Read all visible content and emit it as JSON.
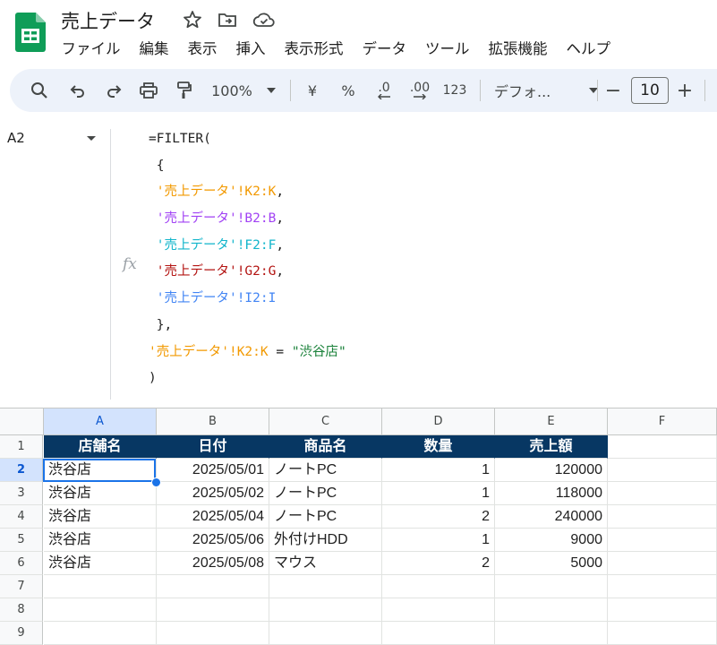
{
  "app": {
    "title": "売上データ",
    "menu": [
      "ファイル",
      "編集",
      "表示",
      "挿入",
      "表示形式",
      "データ",
      "ツール",
      "拡張機能",
      "ヘルプ"
    ]
  },
  "toolbar": {
    "zoom": "100%",
    "currency": "¥",
    "percent": "%",
    "dec_decrease": ".0",
    "dec_increase": ".00",
    "number_format": "123",
    "font": "デフォ...",
    "minus": "−",
    "font_size": "10",
    "plus": "+"
  },
  "formula_bar": {
    "cell_ref": "A2",
    "fx": "fx",
    "line1": "=FILTER(",
    "line2": " {",
    "line3_ref": "'売上データ'!K2:K",
    "line4_ref": "'売上データ'!B2:B",
    "line5_ref": "'売上データ'!F2:F",
    "line6_ref": "'売上データ'!G2:G",
    "line7_ref": "'売上データ'!I2:I",
    "comma": ",",
    "line8": " },",
    "line9_ref": "'売上データ'!K2:K",
    "line9_op": " = ",
    "line9_str": "\"渋谷店\"",
    "line10": ")"
  },
  "sheet": {
    "columns": [
      "A",
      "B",
      "C",
      "D",
      "E",
      "F"
    ],
    "row_numbers": [
      "1",
      "2",
      "3",
      "4",
      "5",
      "6",
      "7",
      "8",
      "9"
    ],
    "header": [
      "店舗名",
      "日付",
      "商品名",
      "数量",
      "売上額"
    ],
    "rows": [
      [
        "渋谷店",
        "2025/05/01",
        "ノートPC",
        "1",
        "120000"
      ],
      [
        "渋谷店",
        "2025/05/02",
        "ノートPC",
        "1",
        "118000"
      ],
      [
        "渋谷店",
        "2025/05/04",
        "ノートPC",
        "2",
        "240000"
      ],
      [
        "渋谷店",
        "2025/05/06",
        "外付けHDD",
        "1",
        "9000"
      ],
      [
        "渋谷店",
        "2025/05/08",
        "マウス",
        "2",
        "5000"
      ]
    ]
  },
  "colors": {
    "header_fill": "#073763",
    "selection": "#1a73e8",
    "toolbar_bg": "#edf2fa"
  }
}
